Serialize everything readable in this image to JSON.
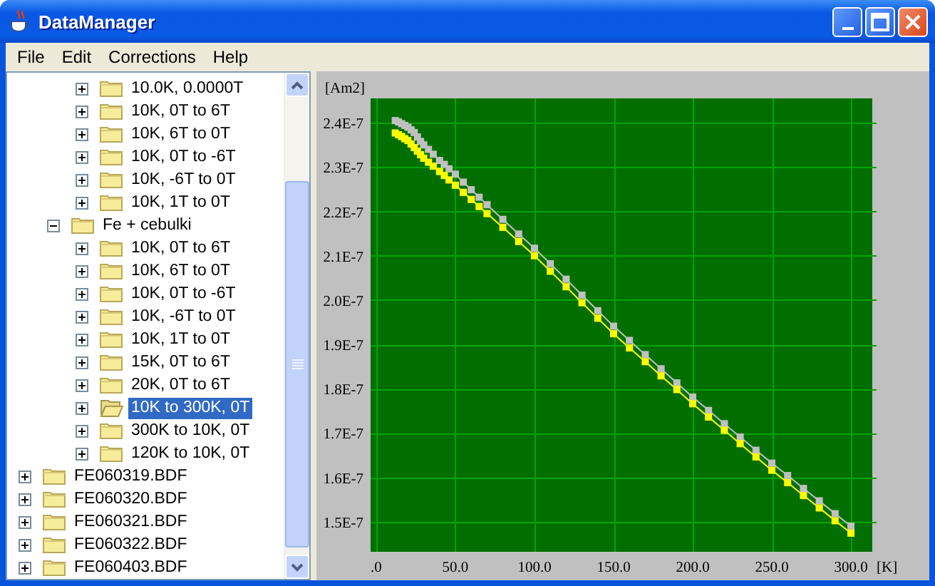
{
  "window": {
    "title": "DataManager"
  },
  "menu": [
    "File",
    "Edit",
    "Corrections",
    "Help"
  ],
  "tree": {
    "items": [
      {
        "children": [
          {
            "children": [
              {
                "label": "10.0K, 0.0000T",
                "expanded": false,
                "selected": false
              },
              {
                "label": "10K, 0T to 6T",
                "expanded": false,
                "selected": false
              },
              {
                "label": "10K, 6T to 0T",
                "expanded": false,
                "selected": false
              },
              {
                "label": "10K, 0T to -6T",
                "expanded": false,
                "selected": false
              },
              {
                "label": "10K, -6T to 0T",
                "expanded": false,
                "selected": false
              },
              {
                "label": "10K, 1T to 0T",
                "expanded": false,
                "selected": false
              }
            ]
          },
          {
            "label": "Fe + cebulki",
            "expanded": true,
            "selected": false,
            "children": [
              {
                "label": "10K, 0T to 6T",
                "expanded": false,
                "selected": false
              },
              {
                "label": "10K, 6T to 0T",
                "expanded": false,
                "selected": false
              },
              {
                "label": "10K, 0T to -6T",
                "expanded": false,
                "selected": false
              },
              {
                "label": "10K, -6T to 0T",
                "expanded": false,
                "selected": false
              },
              {
                "label": "10K, 1T to 0T",
                "expanded": false,
                "selected": false
              },
              {
                "label": "15K, 0T to 6T",
                "expanded": false,
                "selected": false
              },
              {
                "label": "20K, 0T to 6T",
                "expanded": false,
                "selected": false
              },
              {
                "label": "10K to 300K, 0T",
                "expanded": false,
                "selected": true
              },
              {
                "label": "300K to 10K, 0T",
                "expanded": false,
                "selected": false
              },
              {
                "label": "120K to 10K, 0T",
                "expanded": false,
                "selected": false
              }
            ]
          }
        ]
      },
      {
        "label": "FE060319.BDF",
        "expanded": false,
        "selected": false
      },
      {
        "label": "FE060320.BDF",
        "expanded": false,
        "selected": false
      },
      {
        "label": "FE060321.BDF",
        "expanded": false,
        "selected": false
      },
      {
        "label": "FE060322.BDF",
        "expanded": false,
        "selected": false
      },
      {
        "label": "FE060403.BDF",
        "expanded": false,
        "selected": false
      }
    ]
  },
  "chart": {
    "chart_data": {
      "type": "line",
      "grid": true,
      "xlabel": "[K]",
      "ylabel": "[Am2]",
      "x": [
        12,
        14,
        16,
        18,
        20,
        22,
        24,
        26,
        28,
        30,
        33,
        36,
        40,
        43,
        46,
        50,
        55,
        60,
        65,
        70,
        80,
        90,
        100,
        110,
        120,
        130,
        140,
        150,
        160,
        170,
        180,
        190,
        200,
        210,
        220,
        230,
        240,
        250,
        260,
        270,
        280,
        290,
        300
      ],
      "series": [
        {
          "color": "#c0c0c0",
          "marker": "square",
          "values": [
            2.405e-07,
            2.402e-07,
            2.398e-07,
            2.394e-07,
            2.39e-07,
            2.384e-07,
            2.378e-07,
            2.368e-07,
            2.358e-07,
            2.35e-07,
            2.34e-07,
            2.329e-07,
            2.315e-07,
            2.306e-07,
            2.296e-07,
            2.284e-07,
            2.266e-07,
            2.249e-07,
            2.232e-07,
            2.215e-07,
            2.182e-07,
            2.149e-07,
            2.117e-07,
            2.082e-07,
            2.047e-07,
            2.011e-07,
            1.976e-07,
            1.941e-07,
            1.909e-07,
            1.877e-07,
            1.845e-07,
            1.813e-07,
            1.781e-07,
            1.751e-07,
            1.721e-07,
            1.691e-07,
            1.661e-07,
            1.632e-07,
            1.604e-07,
            1.575e-07,
            1.547e-07,
            1.518e-07,
            1.49e-07
          ]
        },
        {
          "color": "#ffff00",
          "marker": "square",
          "values": [
            2.377e-07,
            2.373e-07,
            2.369e-07,
            2.364e-07,
            2.36e-07,
            2.352e-07,
            2.344e-07,
            2.336e-07,
            2.328e-07,
            2.32e-07,
            2.311e-07,
            2.302e-07,
            2.29e-07,
            2.281e-07,
            2.271e-07,
            2.259e-07,
            2.243e-07,
            2.227e-07,
            2.211e-07,
            2.195e-07,
            2.164e-07,
            2.132e-07,
            2.1e-07,
            2.065e-07,
            2.03e-07,
            1.994e-07,
            1.959e-07,
            1.924e-07,
            1.892e-07,
            1.861e-07,
            1.829e-07,
            1.798e-07,
            1.766e-07,
            1.736e-07,
            1.706e-07,
            1.676e-07,
            1.646e-07,
            1.616e-07,
            1.588e-07,
            1.559e-07,
            1.531e-07,
            1.502e-07,
            1.474e-07
          ]
        }
      ],
      "xlim": [
        -3.6,
        313.5
      ],
      "ylim": [
        1.432e-07,
        2.455e-07
      ],
      "xticks": [
        {
          "value": 0,
          "label": ".0"
        },
        {
          "value": 50,
          "label": "50.0"
        },
        {
          "value": 100,
          "label": "100.0"
        },
        {
          "value": 150,
          "label": "150.0"
        },
        {
          "value": 200,
          "label": "200.0"
        },
        {
          "value": 250,
          "label": "250.0"
        },
        {
          "value": 300,
          "label": "300.0"
        }
      ],
      "yticks": [
        {
          "value": 1.5e-07,
          "label": "1.5E-7"
        },
        {
          "value": 1.6e-07,
          "label": "1.6E-7"
        },
        {
          "value": 1.7e-07,
          "label": "1.7E-7"
        },
        {
          "value": 1.8e-07,
          "label": "1.8E-7"
        },
        {
          "value": 1.9e-07,
          "label": "1.9E-7"
        },
        {
          "value": 2e-07,
          "label": "2.0E-7"
        },
        {
          "value": 2.1e-07,
          "label": "2.1E-7"
        },
        {
          "value": 2.2e-07,
          "label": "2.2E-7"
        },
        {
          "value": 2.3e-07,
          "label": "2.3E-7"
        },
        {
          "value": 2.4e-07,
          "label": "2.4E-7"
        }
      ]
    }
  }
}
